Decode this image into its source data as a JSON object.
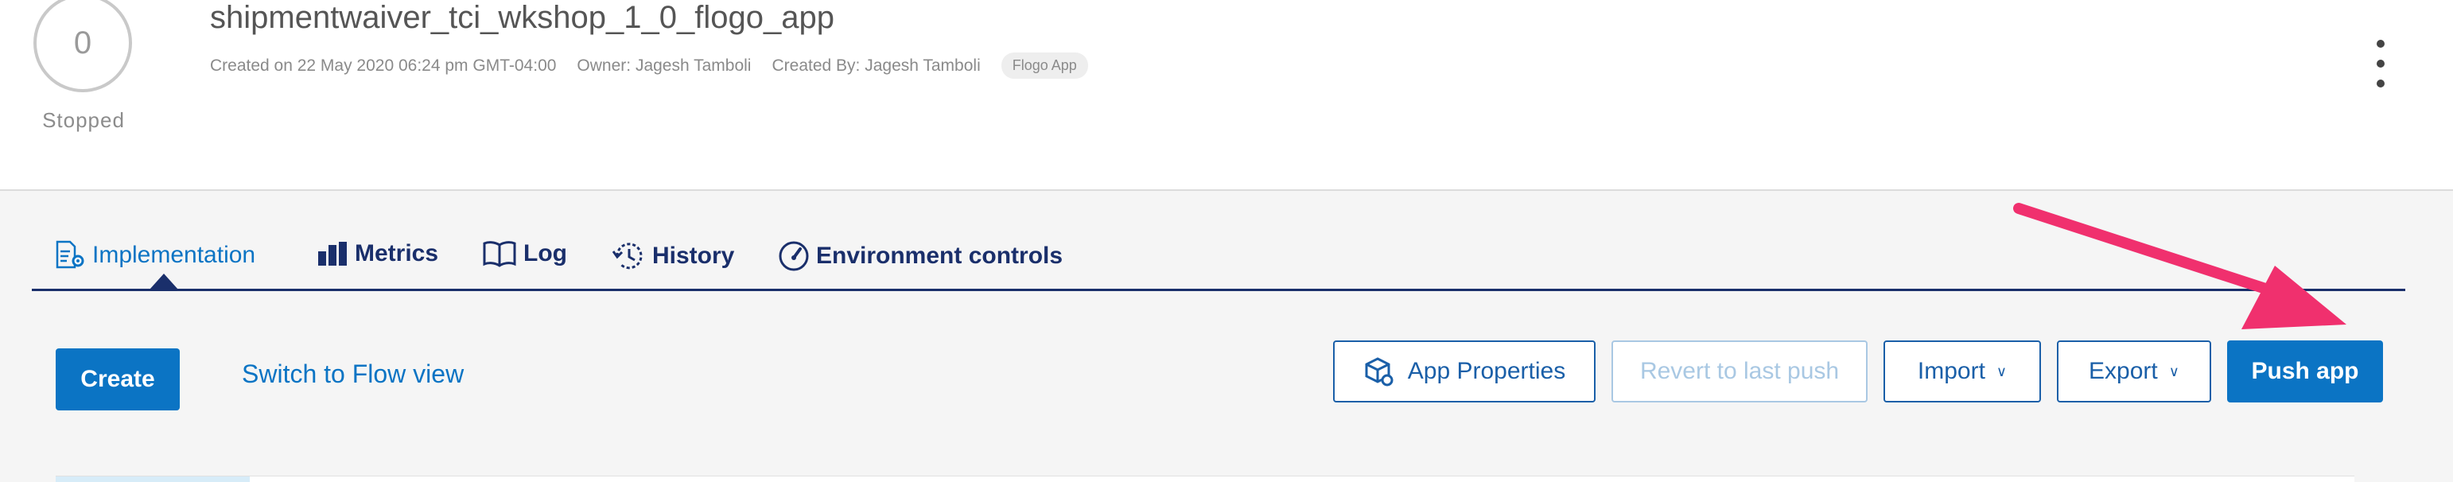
{
  "header": {
    "instance_count": "0",
    "status": "Stopped",
    "app_name": "shipmentwaiver_tci_wkshop_1_0_flogo_app",
    "created_on": "Created on 22 May 2020 06:24 pm GMT-04:00",
    "owner": "Owner: Jagesh Tamboli",
    "created_by": "Created By: Jagesh Tamboli",
    "app_type_badge": "Flogo App"
  },
  "tabs": [
    {
      "label": "Implementation",
      "icon": "implementation-icon",
      "active": true
    },
    {
      "label": "Metrics",
      "icon": "bar-chart-icon"
    },
    {
      "label": "Log",
      "icon": "book-icon"
    },
    {
      "label": "History",
      "icon": "history-icon"
    },
    {
      "label": "Environment controls",
      "icon": "gauge-icon"
    }
  ],
  "toolbar": {
    "create_label": "Create",
    "switch_view_label": "Switch to Flow view",
    "app_properties_label": "App Properties",
    "revert_label": "Revert to last push",
    "import_label": "Import",
    "export_label": "Export",
    "push_label": "Push app"
  },
  "colors": {
    "primary": "#0b74c4",
    "navy": "#1a2f6b",
    "annotation": "#f0306e"
  }
}
